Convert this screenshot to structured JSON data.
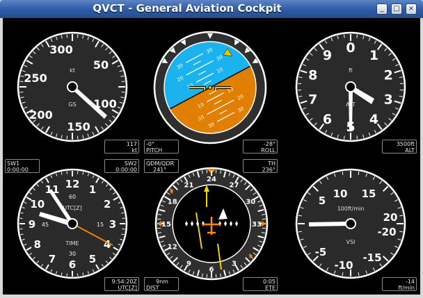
{
  "window": {
    "title": "QVCT - General Aviation Cockpit",
    "buttons": [
      "_",
      "□",
      "×"
    ]
  },
  "instruments": {
    "speed": {
      "scale": [
        "300",
        "50",
        "250",
        "100",
        "200",
        "150"
      ],
      "unit": "kt",
      "label": "GS",
      "box": {
        "value": "117",
        "unit": "kt"
      }
    },
    "attitude": {
      "pitch_scale": [
        "30",
        "20",
        "10",
        "10",
        "20",
        "30",
        "30",
        "20",
        "10",
        "10",
        "20",
        "30"
      ],
      "pitch_box": {
        "value": "-0°",
        "label": "PITCH"
      },
      "roll_box": {
        "value": "-28°",
        "label": "ROLL"
      },
      "colors": {
        "sky": "#1ab3f0",
        "ground": "#e07f00"
      }
    },
    "altimeter": {
      "scale": [
        "0",
        "1",
        "2",
        "3",
        "4",
        "5",
        "6",
        "7",
        "8",
        "9"
      ],
      "unit": "ft",
      "label": "ALT",
      "box": {
        "value": "3500ft",
        "label": "ALT"
      }
    },
    "clock": {
      "hours": [
        "12",
        "1",
        "2",
        "3",
        "4",
        "5",
        "6",
        "7",
        "8",
        "9",
        "10",
        "11"
      ],
      "minutes": [
        "60",
        "15",
        "30",
        "45"
      ],
      "label_top": "UTC[Z]",
      "label_bottom": "TIME",
      "box": {
        "value": "9:54:20Z",
        "label": "UTC[Z]"
      }
    },
    "hsi": {
      "headings": [
        "24",
        "27",
        "30",
        "33",
        "3",
        "6",
        "9",
        "12",
        "15",
        "18",
        "21"
      ],
      "dist_box": {
        "value": "9nm",
        "label": "DIST"
      },
      "ete_box": {
        "value": "0:05",
        "label": "ETE"
      },
      "qdm_box": {
        "label": "QDM/QDR",
        "value": "241°"
      },
      "th_box": {
        "label": "TH",
        "value": "236°"
      }
    },
    "vsi": {
      "scale": [
        "10",
        "15",
        "20",
        "-20",
        "-15",
        "-10",
        "-5",
        "5"
      ],
      "unit": "100ft/min",
      "label": "VSI",
      "box": {
        "value": "-14",
        "unit": "ft/min"
      }
    }
  },
  "switches": {
    "sw1": {
      "label": "SW1",
      "value": "0:00:00"
    },
    "sw2": {
      "label": "SW2",
      "value": "0:00:00"
    }
  }
}
